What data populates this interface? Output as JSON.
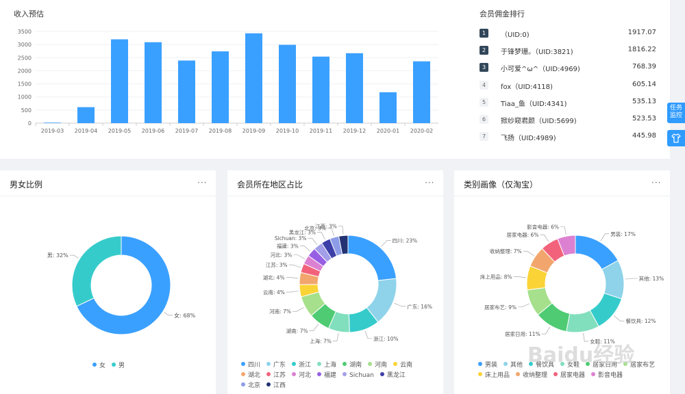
{
  "income": {
    "title": "收入预估",
    "chart_data": {
      "type": "bar",
      "title": "收入预估",
      "categories": [
        "2019-03",
        "2019-04",
        "2019-05",
        "2019-06",
        "2019-07",
        "2019-08",
        "2019-09",
        "2019-10",
        "2019-11",
        "2019-12",
        "2020-01",
        "2020-02"
      ],
      "values": [
        20,
        610,
        3200,
        3090,
        2390,
        2740,
        3430,
        2990,
        2540,
        2670,
        1180,
        2360
      ],
      "ylim": [
        0,
        3500
      ],
      "yticks": [
        "0",
        "500",
        "1000",
        "1500",
        "2000",
        "2500",
        "3000",
        "3500"
      ],
      "color": "#3aa0ff",
      "grid": true
    }
  },
  "ranking": {
    "title": "会员佣金排行",
    "rows": [
      {
        "rank": "1",
        "name": "（UID:0)",
        "value": "1917.07"
      },
      {
        "rank": "2",
        "name": "于锋梦珊。（UID:3821)",
        "value": "1816.22"
      },
      {
        "rank": "3",
        "name": "小可爱^ω^（UID:4969)",
        "value": "768.39"
      },
      {
        "rank": "4",
        "name": "fox（UID:4118)",
        "value": "605.14"
      },
      {
        "rank": "5",
        "name": "Tiaa_鱼（UID:4341)",
        "value": "535.13"
      },
      {
        "rank": "6",
        "name": "掀纱窥君颜（UID:5699)",
        "value": "523.53"
      },
      {
        "rank": "7",
        "name": "飞扬（UID:4989)",
        "value": "445.98"
      }
    ]
  },
  "gender": {
    "title": "男女比例",
    "more": "···",
    "chart_data": {
      "type": "pie",
      "title": "男女比例",
      "slices": [
        {
          "name": "女",
          "label": "女: 68%",
          "value": 68,
          "color": "#3aa0ff"
        },
        {
          "name": "男",
          "label": "男: 32%",
          "value": 32,
          "color": "#36cbcb"
        }
      ],
      "legend": [
        "女",
        "男"
      ],
      "legend_position": "bottom"
    }
  },
  "region": {
    "title": "会员所在地区占比",
    "more": "···",
    "chart_data": {
      "type": "pie",
      "title": "会员所在地区占比",
      "slices": [
        {
          "name": "四川",
          "label": "四川: 23%",
          "value": 23,
          "color": "#3aa0ff"
        },
        {
          "name": "广东",
          "label": "广东: 16%",
          "value": 16,
          "color": "#8ed3ea"
        },
        {
          "name": "浙江",
          "label": "浙江: 10%",
          "value": 10,
          "color": "#36cbcb"
        },
        {
          "name": "上海",
          "label": "上海: 7%",
          "value": 7,
          "color": "#82dfbe"
        },
        {
          "name": "湖南",
          "label": "湖南: 7%",
          "value": 7,
          "color": "#4ecb73"
        },
        {
          "name": "河南",
          "label": "河南: 7%",
          "value": 7,
          "color": "#a6e08c"
        },
        {
          "name": "云南",
          "label": "云南: 4%",
          "value": 4,
          "color": "#fad337"
        },
        {
          "name": "湖北",
          "label": "湖北: 4%",
          "value": 4,
          "color": "#f2a66d"
        },
        {
          "name": "江苏",
          "label": "江苏: 3%",
          "value": 3,
          "color": "#f2637b"
        },
        {
          "name": "河北",
          "label": "河北: 3%",
          "value": 3,
          "color": "#dc81d2"
        },
        {
          "name": "福建",
          "label": "福建: 3%",
          "value": 3,
          "color": "#975fe4"
        },
        {
          "name": "Sichuan",
          "label": "Sichuan: 3%",
          "value": 3,
          "color": "#a39ee8"
        },
        {
          "name": "黑龙江",
          "label": "黑龙江: 3%",
          "value": 3,
          "color": "#3d3fa8"
        },
        {
          "name": "北京",
          "label": "北京: 3%",
          "value": 3,
          "color": "#8c9ce6"
        },
        {
          "name": "江西",
          "label": "江西: 3%",
          "value": 3,
          "color": "#223273"
        }
      ],
      "legend": [
        "四川",
        "广东",
        "浙江",
        "上海",
        "湖南",
        "河南",
        "云南",
        "湖北",
        "江苏",
        "河北",
        "福建",
        "Sichuan",
        "黑龙江",
        "北京",
        "江西"
      ],
      "legend_position": "bottom"
    }
  },
  "category": {
    "title": "类别画像（仅淘宝）",
    "more": "···",
    "chart_data": {
      "type": "pie",
      "title": "类别画像（仅淘宝）",
      "slices": [
        {
          "name": "男装",
          "label": "男装: 17%",
          "value": 17,
          "color": "#3aa0ff"
        },
        {
          "name": "其他",
          "label": "其他: 13%",
          "value": 13,
          "color": "#8ed3ea"
        },
        {
          "name": "餐饮具",
          "label": "餐饮具: 12%",
          "value": 12,
          "color": "#36cbcb"
        },
        {
          "name": "女鞋",
          "label": "女鞋: 11%",
          "value": 11,
          "color": "#82dfbe"
        },
        {
          "name": "居家日用",
          "label": "居家日用: 11%",
          "value": 11,
          "color": "#4ecb73"
        },
        {
          "name": "居家布艺",
          "label": "居家布艺: 9%",
          "value": 9,
          "color": "#a6e08c"
        },
        {
          "name": "床上用品",
          "label": "床上用品: 8%",
          "value": 8,
          "color": "#fad337"
        },
        {
          "name": "收纳整理",
          "label": "收纳整理: 7%",
          "value": 7,
          "color": "#f2a66d"
        },
        {
          "name": "居家电器",
          "label": "居家电器: 6%",
          "value": 6,
          "color": "#f2637b"
        },
        {
          "name": "影音电器",
          "label": "影音电器: 6%",
          "value": 6,
          "color": "#dc81d2"
        }
      ],
      "legend": [
        "男装",
        "其他",
        "餐饮具",
        "女鞋",
        "居家日用",
        "居家布艺",
        "床上用品",
        "收纳整理",
        "居家电器",
        "影音电器"
      ],
      "legend_position": "bottom"
    }
  },
  "side": {
    "task_monitor": "任务监控",
    "shirt_icon": "shirt-icon"
  },
  "watermark": "Baidu经验"
}
